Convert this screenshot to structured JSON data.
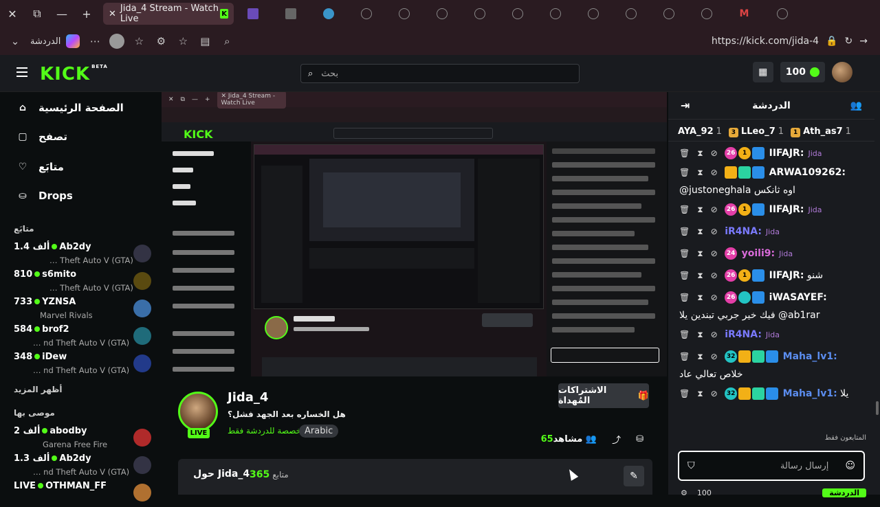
{
  "browser": {
    "active_tab_title": "Jida_4 Stream - Watch Live",
    "copilot_label": "الدردشة",
    "url_host": "kick.com",
    "url_full": "https://kick.com/jida-4"
  },
  "nav": {
    "search_placeholder": "بحث",
    "coins": "100",
    "logo": "KICK",
    "logo_sup": "BETA"
  },
  "sidebar": {
    "links": [
      {
        "label": "الصفحة الرئيسية",
        "icon": "home-icon"
      },
      {
        "label": "تصفح",
        "icon": "browse-icon"
      },
      {
        "label": "متابَع",
        "icon": "heart-icon"
      },
      {
        "label": "Drops",
        "icon": "drops-icon"
      }
    ],
    "following_head": "متابَع",
    "following": [
      {
        "name": "Ab2dy",
        "viewers": "1.4 ألف",
        "game": "… Theft Auto V (GTA)"
      },
      {
        "name": "s6mito",
        "viewers": "810",
        "game": "… Theft Auto V (GTA)"
      },
      {
        "name": "YZNSA",
        "viewers": "733",
        "game": "Marvel Rivals"
      },
      {
        "name": "brof2",
        "viewers": "584",
        "game": "… nd Theft Auto V (GTA)"
      },
      {
        "name": "iDew",
        "viewers": "348",
        "game": "… nd Theft Auto V (GTA)"
      }
    ],
    "show_more": "أظهر المزيد",
    "recommended_head": "موصى بها",
    "recommended": [
      {
        "name": "abodby",
        "viewers": "2 ألف",
        "game": "Garena Free Fire"
      },
      {
        "name": "Ab2dy",
        "viewers": "1.3 ألف",
        "game": "… nd Theft Auto V (GTA)"
      },
      {
        "name": "OTHMAN_FF",
        "viewers": "LIVE",
        "game": ""
      }
    ]
  },
  "stream": {
    "name": "Jida_4",
    "live_label": "LIVE",
    "title": "هل الخساره بعد الجهد فشل؟",
    "category": "مخصصة للدردشة فقط",
    "language": "Arabic",
    "gift_subs_label": "الاشتراكات المُهداة",
    "viewers_label": "مشاهد",
    "viewers_count": "65",
    "about_label": "حول Jida_4",
    "followers_count": "365",
    "followers_label": "متابع"
  },
  "chat": {
    "title": "الدردشة",
    "gifters": [
      {
        "rank": "1",
        "name": "Ath_as7",
        "count": "1"
      },
      {
        "rank": "3",
        "name": "LLeo_7",
        "count": "1"
      },
      {
        "rank": "",
        "name": "AYA_92",
        "count": "1"
      }
    ],
    "messages": [
      {
        "badges": [
          "26",
          "1"
        ],
        "user": "IIFAJR:",
        "color": "#ffffff",
        "text": "",
        "channel": "Jida"
      },
      {
        "badges": [],
        "user": "ARWA109262:",
        "color": "#ffffff",
        "text": "@justoneghala اوه ثانكس",
        "channel": ""
      },
      {
        "badges": [
          "26",
          "1"
        ],
        "user": "IIFAJR:",
        "color": "#ffffff",
        "text": "",
        "channel": "Jida"
      },
      {
        "badges": [],
        "user": "iR4NA:",
        "color": "#7a7aff",
        "text": "",
        "channel": "Jida"
      },
      {
        "badges": [
          "24"
        ],
        "user": "yoili9:",
        "color": "#d96bd9",
        "text": "",
        "channel": "Jida"
      },
      {
        "badges": [
          "26",
          "1"
        ],
        "user": "IIFAJR:",
        "color": "#ffffff",
        "text": "شنو",
        "channel": ""
      },
      {
        "badges": [
          "26"
        ],
        "user": "iWASAYEF:",
        "color": "#ffffff",
        "text": "فيك خير جربي تبندين يلا @ab1rar",
        "channel": ""
      },
      {
        "badges": [],
        "user": "iR4NA:",
        "color": "#7a7aff",
        "text": "",
        "channel": "Jida"
      },
      {
        "badges": [
          "32"
        ],
        "user": "Maha_lv1:",
        "color": "#5b8def",
        "text": "خلاص تعالي عاد",
        "channel": ""
      },
      {
        "badges": [
          "32"
        ],
        "user": "Maha_lv1:",
        "color": "#5b8def",
        "text": "يلا",
        "channel": ""
      }
    ],
    "followers_only": "المتابعون فقط",
    "input_placeholder": "إرسال رسالة",
    "footer_count": "100",
    "footer_button": "الدردشة"
  }
}
